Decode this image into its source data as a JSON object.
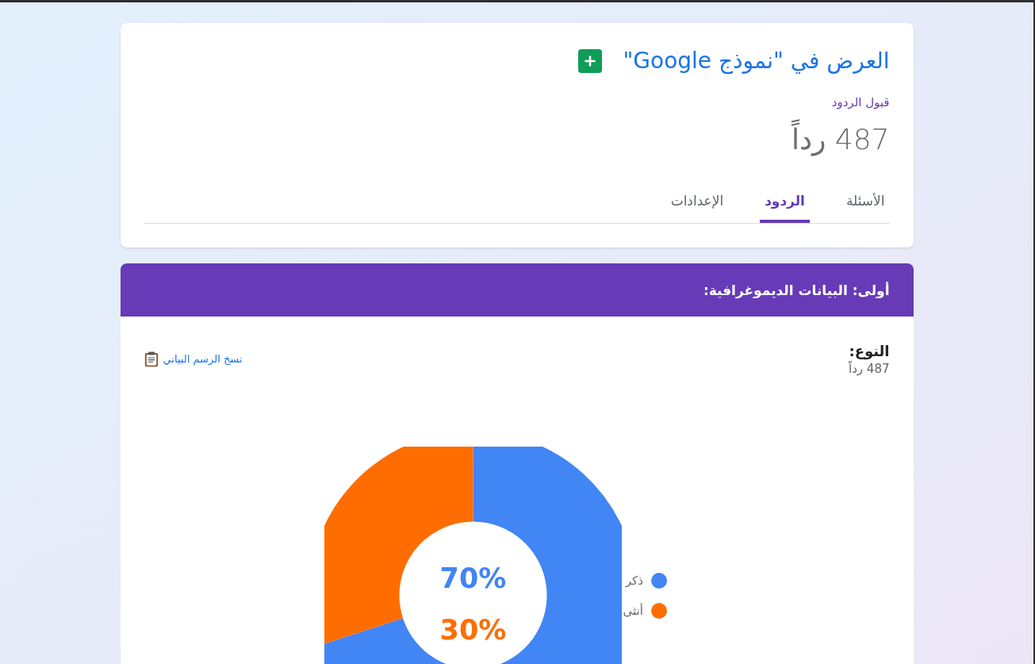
{
  "form_header": {
    "title": "العرض في \"نموذج Google\"",
    "status": "قبول الردود",
    "response_count": "487 رداً",
    "tabs": [
      {
        "label": "الأسئلة",
        "selected": false
      },
      {
        "label": "الردود",
        "selected": true
      },
      {
        "label": "الإعدادات",
        "selected": false
      }
    ]
  },
  "section": {
    "title": "أولى: البيانات الديموغرافية:",
    "question": {
      "title": "النوع:",
      "response_count": "487 رداً",
      "copy_link": "نسخ الرسم البياني",
      "chart_data": {
        "type": "donut",
        "categories": [
          "ذكر",
          "أنثى"
        ],
        "values": [
          70,
          30
        ],
        "colors": [
          "#4285f4",
          "#ff6d00"
        ],
        "value_labels": [
          "70%",
          "30%"
        ],
        "legend": "right"
      }
    }
  }
}
